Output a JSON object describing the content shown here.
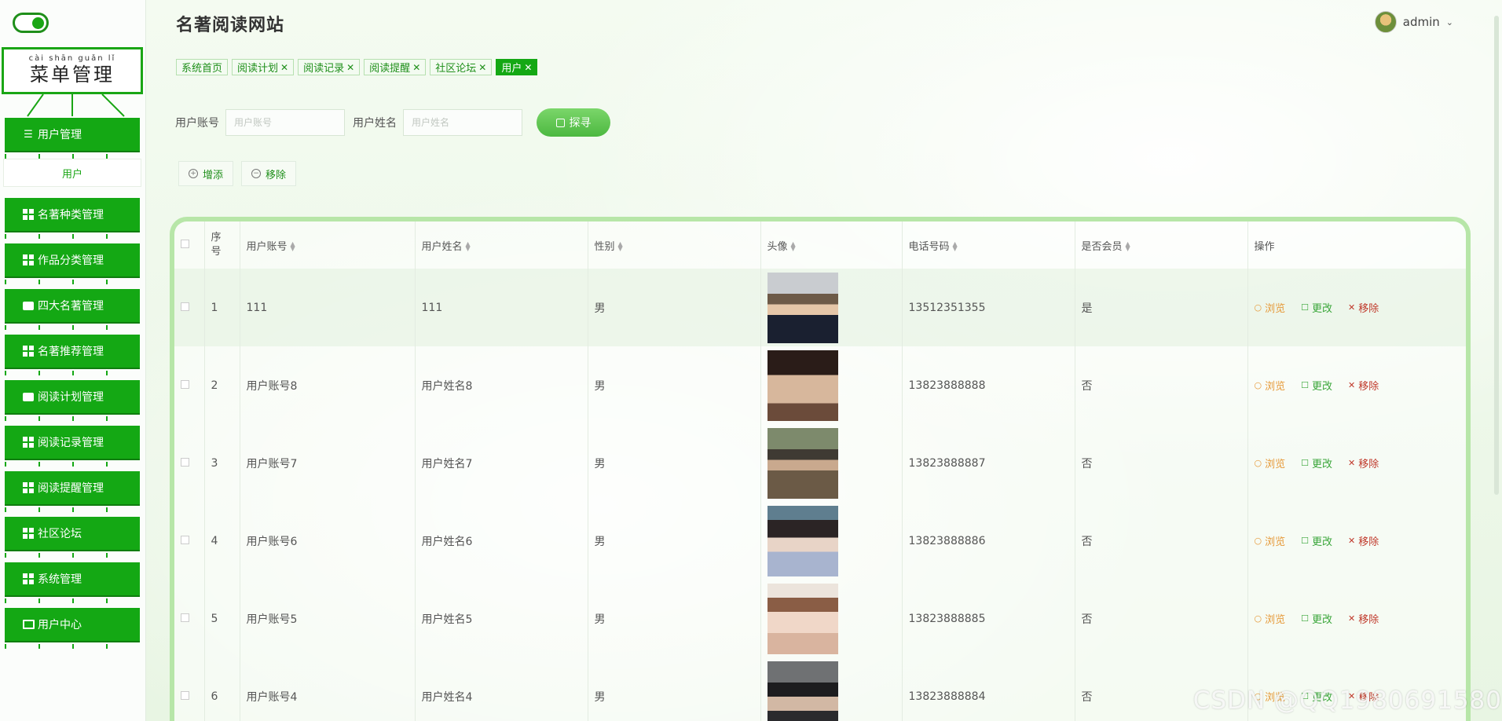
{
  "sidebar": {
    "menu_title": "菜单管理",
    "menu_title_pinyin": "cài shān guǎn  lǐ",
    "items": [
      {
        "label": "用户管理",
        "icon": "list-icon"
      },
      {
        "label": "名著种类管理",
        "icon": "grid-icon"
      },
      {
        "label": "作品分类管理",
        "icon": "grid-icon"
      },
      {
        "label": "四大名著管理",
        "icon": "briefcase-icon"
      },
      {
        "label": "名著推荐管理",
        "icon": "grid-icon"
      },
      {
        "label": "阅读计划管理",
        "icon": "chat-icon"
      },
      {
        "label": "阅读记录管理",
        "icon": "grid-icon"
      },
      {
        "label": "阅读提醒管理",
        "icon": "grid-icon"
      },
      {
        "label": "社区论坛",
        "icon": "grid-icon"
      },
      {
        "label": "系统管理",
        "icon": "grid-icon"
      },
      {
        "label": "用户中心",
        "icon": "card-icon"
      }
    ],
    "sub_item": "用户"
  },
  "header": {
    "title": "名著阅读网站",
    "user": "admin"
  },
  "tabs": [
    {
      "label": "系统首页",
      "closable": false
    },
    {
      "label": "阅读计划",
      "closable": true
    },
    {
      "label": "阅读记录",
      "closable": true
    },
    {
      "label": "阅读提醒",
      "closable": true
    },
    {
      "label": "社区论坛",
      "closable": true
    },
    {
      "label": "用户",
      "closable": true,
      "active": true
    }
  ],
  "search": {
    "account_label": "用户账号",
    "account_placeholder": "用户账号",
    "name_label": "用户姓名",
    "name_placeholder": "用户姓名",
    "button": "探寻"
  },
  "actions": {
    "add": "增添",
    "remove": "移除"
  },
  "table": {
    "headers": {
      "index": "序号",
      "account": "用户账号",
      "name": "用户姓名",
      "gender": "性别",
      "avatar": "头像",
      "phone": "电话号码",
      "member": "是否会员",
      "ops": "操作"
    },
    "op_labels": {
      "view": "浏览",
      "edit": "更改",
      "delete": "移除"
    },
    "rows": [
      {
        "index": "1",
        "account": "111",
        "name": "111",
        "gender": "男",
        "phone": "13512351355",
        "member": "是"
      },
      {
        "index": "2",
        "account": "用户账号8",
        "name": "用户姓名8",
        "gender": "男",
        "phone": "13823888888",
        "member": "否"
      },
      {
        "index": "3",
        "account": "用户账号7",
        "name": "用户姓名7",
        "gender": "男",
        "phone": "13823888887",
        "member": "否"
      },
      {
        "index": "4",
        "account": "用户账号6",
        "name": "用户姓名6",
        "gender": "男",
        "phone": "13823888886",
        "member": "否"
      },
      {
        "index": "5",
        "account": "用户账号5",
        "name": "用户姓名5",
        "gender": "男",
        "phone": "13823888885",
        "member": "否"
      },
      {
        "index": "6",
        "account": "用户账号4",
        "name": "用户姓名4",
        "gender": "男",
        "phone": "13823888884",
        "member": "否"
      }
    ]
  },
  "watermark": "CSDN @QQ1980691580",
  "colors": {
    "primary": "#14a814",
    "tab_bg": "#f3fbf1",
    "view": "#e69a3a",
    "edit": "#3aa63a",
    "delete": "#c0392b"
  }
}
